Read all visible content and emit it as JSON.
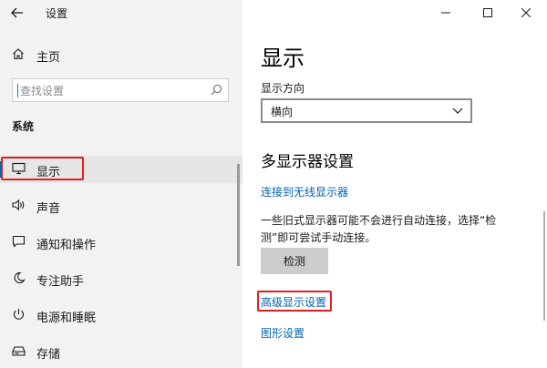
{
  "window": {
    "title": "设置",
    "controls": {
      "minimize": "minimize-icon",
      "maximize": "maximize-icon",
      "close": "close-icon"
    }
  },
  "sidebar": {
    "home_label": "主页",
    "search_placeholder": "查找设置",
    "section_label": "系统",
    "items": [
      {
        "label": "显示",
        "icon": "monitor-icon",
        "selected": true
      },
      {
        "label": "声音",
        "icon": "speaker-icon",
        "selected": false
      },
      {
        "label": "通知和操作",
        "icon": "notification-icon",
        "selected": false
      },
      {
        "label": "专注助手",
        "icon": "moon-icon",
        "selected": false
      },
      {
        "label": "电源和睡眠",
        "icon": "power-icon",
        "selected": false
      },
      {
        "label": "存储",
        "icon": "storage-icon",
        "selected": false
      }
    ]
  },
  "main": {
    "title": "显示",
    "orientation_label": "显示方向",
    "orientation_value": "横向",
    "multi_display_title": "多显示器设置",
    "wireless_link": "连接到无线显示器",
    "detect_description": "一些旧式显示器可能不会进行自动连接，选择“检测”即可尝试手动连接。",
    "detect_button": "检测",
    "advanced_link": "高级显示设置",
    "graphics_link": "图形设置"
  },
  "colors": {
    "accent": "#0063b1",
    "highlight": "#e02020",
    "sidebar_bg": "#f2f2f2"
  }
}
